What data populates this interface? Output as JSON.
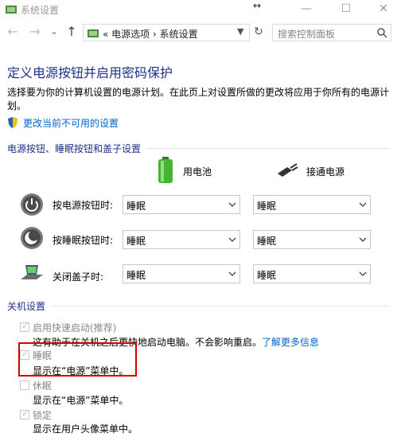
{
  "window": {
    "title": "系统设置"
  },
  "nav": {
    "back": "←",
    "forward": "→",
    "recent": "⌄",
    "up": "↑",
    "address_prefix": "«",
    "breadcrumb": [
      "电源选项",
      "系统设置"
    ],
    "breadcrumb_sep": "›",
    "search_placeholder": "搜索控制面板"
  },
  "page": {
    "title": "定义电源按钮并启用密码保护",
    "description": "选择要为你的计算机设置的电源计划。在此页上对设置所做的更改将应用于你所有的电源计划。",
    "change_link": "更改当前不可用的设置"
  },
  "buttons_section": {
    "heading": "电源按钮、睡眠按钮和盖子设置",
    "battery_label": "用电池",
    "plugged_label": "接通电源",
    "rows": [
      {
        "label": "按电源按钮时:",
        "battery": "睡眠",
        "plugged": "睡眠"
      },
      {
        "label": "按睡眠按钮时:",
        "battery": "睡眠",
        "plugged": "睡眠"
      },
      {
        "label": "关闭盖子时:",
        "battery": "睡眠",
        "plugged": "睡眠"
      }
    ]
  },
  "shutdown_section": {
    "heading": "关机设置",
    "options": [
      {
        "label": "启用快速启动(推荐)",
        "checked": true,
        "desc": "这有助于在关机之后更快地启动电脑。不会影响重启。",
        "link": "了解更多信息"
      },
      {
        "label": "睡眠",
        "checked": true,
        "desc": "显示在“电源”菜单中。"
      },
      {
        "label": "休眠",
        "checked": false,
        "desc": "显示在“电源”菜单中。"
      },
      {
        "label": "锁定",
        "checked": true,
        "desc": "显示在用户头像菜单中。"
      }
    ]
  },
  "colors": {
    "heading": "#1e3287",
    "link": "#0066cc",
    "highlight": "#d40000"
  }
}
